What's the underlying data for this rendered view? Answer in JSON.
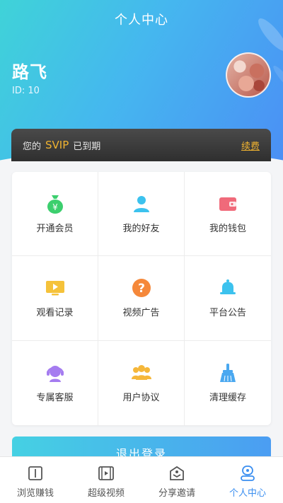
{
  "header": {
    "title": "个人中心"
  },
  "user": {
    "name": "路飞",
    "id_text": "ID: 10"
  },
  "vip": {
    "prefix": "您的",
    "level": "SVIP",
    "suffix": "已到期",
    "renew": "续费"
  },
  "grid": [
    {
      "label": "开通会员",
      "icon": "money-bag-icon",
      "color": "#3ccf6e"
    },
    {
      "label": "我的好友",
      "icon": "person-icon",
      "color": "#3cc2ee"
    },
    {
      "label": "我的钱包",
      "icon": "wallet-icon",
      "color": "#f06a7a"
    },
    {
      "label": "观看记录",
      "icon": "video-play-icon",
      "color": "#f5c23a"
    },
    {
      "label": "视频广告",
      "icon": "question-icon",
      "color": "#f5883a"
    },
    {
      "label": "平台公告",
      "icon": "bell-icon",
      "color": "#3cc2ee"
    },
    {
      "label": "专属客服",
      "icon": "headset-icon",
      "color": "#a57cf0"
    },
    {
      "label": "用户协议",
      "icon": "group-icon",
      "color": "#f5b73a"
    },
    {
      "label": "清理缓存",
      "icon": "broom-icon",
      "color": "#4aa8f0"
    }
  ],
  "logout": {
    "label": "退出登录"
  },
  "tabbar": [
    {
      "label": "浏览赚钱",
      "icon": "book-icon",
      "active": false
    },
    {
      "label": "超级视频",
      "icon": "film-icon",
      "active": false
    },
    {
      "label": "分享邀请",
      "icon": "share-box-icon",
      "active": false
    },
    {
      "label": "个人中心",
      "icon": "user-icon",
      "active": true
    }
  ],
  "colors": {
    "accent": "#3a8ef0",
    "gold": "#f0b330"
  }
}
